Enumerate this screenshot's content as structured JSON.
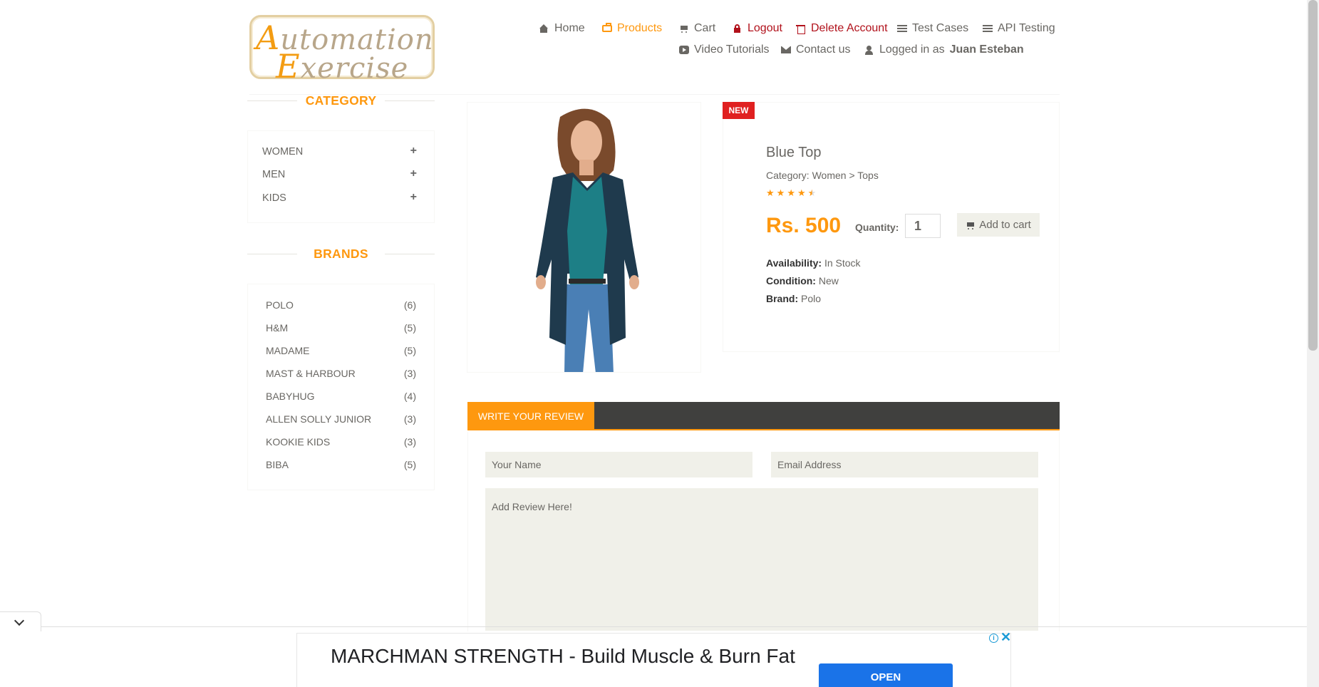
{
  "logo": {
    "line1_cap": "A",
    "line1_rest": "utomation",
    "line2_cap": "E",
    "line2_rest": "xercise"
  },
  "nav": {
    "home": "Home",
    "products": "Products",
    "cart": "Cart",
    "logout": "Logout",
    "delete_account": "Delete Account",
    "test_cases": "Test Cases",
    "api_testing": "API Testing",
    "video_tutorials": "Video Tutorials",
    "contact_us": "Contact us",
    "logged_in_prefix": "Logged in as",
    "logged_in_user": "Juan Esteban"
  },
  "sidebar": {
    "category_title": "CATEGORY",
    "categories": [
      {
        "label": "WOMEN",
        "toggle": "+"
      },
      {
        "label": "MEN",
        "toggle": "+"
      },
      {
        "label": "KIDS",
        "toggle": "+"
      }
    ],
    "brands_title": "BRANDS",
    "brands": [
      {
        "name": "POLO",
        "count": "(6)"
      },
      {
        "name": "H&M",
        "count": "(5)"
      },
      {
        "name": "MADAME",
        "count": "(5)"
      },
      {
        "name": "MAST & HARBOUR",
        "count": "(3)"
      },
      {
        "name": "BABYHUG",
        "count": "(4)"
      },
      {
        "name": "ALLEN SOLLY JUNIOR",
        "count": "(3)"
      },
      {
        "name": "KOOKIE KIDS",
        "count": "(3)"
      },
      {
        "name": "BIBA",
        "count": "(5)"
      }
    ]
  },
  "product": {
    "badge": "NEW",
    "name": "Blue Top",
    "category": "Category: Women > Tops",
    "rating": 4.5,
    "price": "Rs. 500",
    "quantity_label": "Quantity:",
    "quantity_value": "1",
    "add_to_cart": "Add to cart",
    "availability_label": "Availability:",
    "availability_value": "In Stock",
    "condition_label": "Condition:",
    "condition_value": "New",
    "brand_label": "Brand:",
    "brand_value": "Polo"
  },
  "review": {
    "tab_label": "WRITE YOUR REVIEW",
    "name_placeholder": "Your Name",
    "email_placeholder": "Email Address",
    "review_placeholder": "Add Review Here!"
  },
  "ad": {
    "headline": "MARCHMAN STRENGTH - Build Muscle & Burn Fat",
    "cta": "OPEN",
    "info_icon": "i",
    "close_icon": "✕"
  },
  "colors": {
    "accent": "#fe980f",
    "danger": "#b1111b",
    "text": "#696763",
    "review_bar": "#40403e",
    "ad_button": "#1a73e8"
  }
}
